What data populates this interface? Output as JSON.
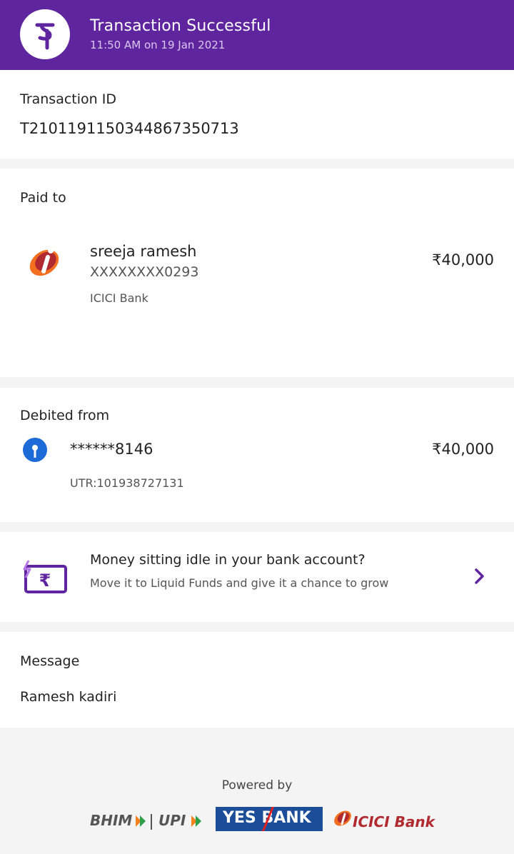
{
  "header": {
    "title": "Transaction Successful",
    "subtitle": "11:50 AM on 19 Jan 2021",
    "logo": "phonepe-logo"
  },
  "transaction": {
    "id_label": "Transaction ID",
    "id_value": "T2101191150344867350713"
  },
  "paid_to": {
    "label": "Paid to",
    "name": "sreeja ramesh",
    "account": "XXXXXXXX0293",
    "bank": "ICICI Bank",
    "amount": "₹40,000",
    "icon": "icici-bank-icon"
  },
  "debited_from": {
    "label": "Debited from",
    "account": "******8146",
    "utr": "UTR:101938727131",
    "amount": "₹40,000",
    "icon": "sbi-bank-icon"
  },
  "promo": {
    "title": "Money sitting idle in your bank account?",
    "subtitle": "Move it to Liquid Funds and give it a chance to grow",
    "icon": "wallet-rupee-icon"
  },
  "message": {
    "label": "Message",
    "value": "Ramesh kadiri"
  },
  "footer": {
    "powered_by": "Powered by",
    "partners": [
      "BHIM",
      "UPI",
      "YES BANK",
      "ICICI Bank"
    ]
  },
  "colors": {
    "brand": "#5f259f",
    "yes_bank": "#1b4d98",
    "icici_orange": "#f37021",
    "icici_red": "#b02a30",
    "sbi_blue": "#1c6bd6"
  }
}
